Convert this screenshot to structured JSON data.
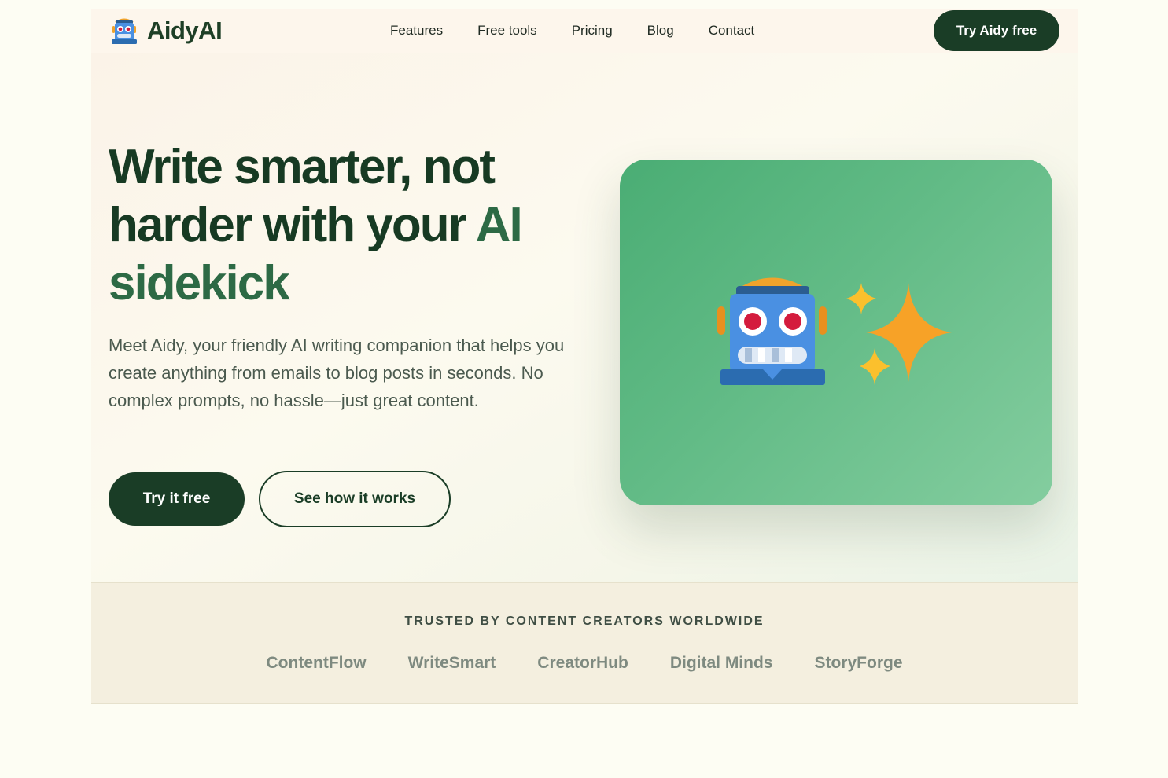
{
  "brand": {
    "name": "AidyAI",
    "logo_icon": "robot-icon"
  },
  "nav": {
    "links": [
      "Features",
      "Free tools",
      "Pricing",
      "Blog",
      "Contact"
    ],
    "cta": "Try Aidy free"
  },
  "hero": {
    "title_main": "Write smarter, not harder with your ",
    "title_accent": "AI sidekick",
    "subtitle": "Meet Aidy, your friendly AI writing companion that helps you create anything from emails to blog posts in seconds. No complex prompts, no hassle—just great content.",
    "primary_button": "Try it free",
    "secondary_button": "See how it works",
    "illustration": [
      "robot-icon",
      "sparkles-icon"
    ]
  },
  "trusted": {
    "label": "TRUSTED BY CONTENT CREATORS WORLDWIDE",
    "brands": [
      "ContentFlow",
      "WriteSmart",
      "CreatorHub",
      "Digital Minds",
      "StoryForge"
    ]
  },
  "colors": {
    "primary": "#1a3d26",
    "accent": "#2d6a45",
    "card_green": "#4aad74",
    "robot_blue": "#4a90e2",
    "sparkle_orange": "#f7a227"
  }
}
